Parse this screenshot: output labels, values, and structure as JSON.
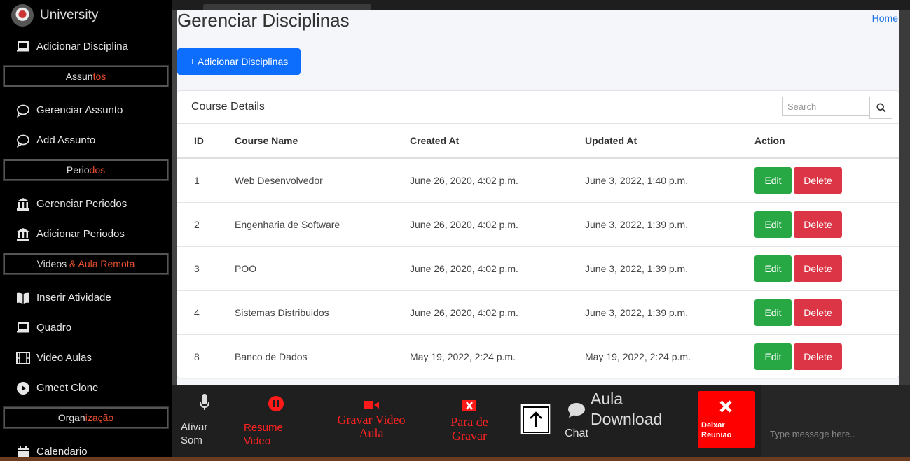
{
  "sidebar": {
    "brand": "University",
    "items_top": [
      {
        "label": "Adicionar Disciplina",
        "icon": "laptop-icon"
      }
    ],
    "sections": [
      {
        "plain": "Assun",
        "accent": "tos",
        "items": [
          {
            "label": "Gerenciar Assunto",
            "icon": "chat-icon"
          },
          {
            "label": "Add Assunto",
            "icon": "chat-icon"
          }
        ]
      },
      {
        "plain": "Perio",
        "accent": "dos",
        "items": [
          {
            "label": "Gerenciar Periodos",
            "icon": "bank-icon"
          },
          {
            "label": "Adicionar Periodos",
            "icon": "bank-icon"
          }
        ]
      },
      {
        "plain": "Videos ",
        "accent": "& Aula Remota",
        "items": [
          {
            "label": "Inserir Atividade",
            "icon": "book-icon"
          },
          {
            "label": "Quadro",
            "icon": "laptop-icon"
          },
          {
            "label": "Video Aulas",
            "icon": "film-icon"
          },
          {
            "label": "Gmeet Clone",
            "icon": "play-icon"
          }
        ]
      },
      {
        "plain": "Organ",
        "accent": "ização",
        "items": [
          {
            "label": "Calendario",
            "icon": "calendar-icon"
          }
        ]
      }
    ]
  },
  "main": {
    "title": "Gerenciar Disciplinas",
    "home": "Home",
    "add_button": "+ Adicionar Disciplinas",
    "card_title": "Course Details",
    "search_placeholder": "Search",
    "columns": [
      "ID",
      "Course Name",
      "Created At",
      "Updated At",
      "Action"
    ],
    "rows": [
      {
        "id": "1",
        "name": "Web Desenvolvedor",
        "created": "June 26, 2020, 4:02 p.m.",
        "updated": "June 3, 2022, 1:40 p.m."
      },
      {
        "id": "2",
        "name": "Engenharia de Software",
        "created": "June 26, 2020, 4:02 p.m.",
        "updated": "June 3, 2022, 1:39 p.m."
      },
      {
        "id": "3",
        "name": "POO",
        "created": "June 26, 2020, 4:02 p.m.",
        "updated": "June 3, 2022, 1:39 p.m."
      },
      {
        "id": "4",
        "name": "Sistemas Distribuidos",
        "created": "June 26, 2020, 4:02 p.m.",
        "updated": "June 3, 2022, 1:39 p.m."
      },
      {
        "id": "8",
        "name": "Banco de Dados",
        "created": "May 19, 2022, 2:24 p.m.",
        "updated": "May 19, 2022, 2:24 p.m."
      }
    ],
    "edit_label": "Edit",
    "delete_label": "Delete"
  },
  "controls": {
    "mic": "Ativar Som",
    "resume": "Resume Video",
    "record": "Gravar Video Aula",
    "stop": "Para de Gravar",
    "chat": "Chat",
    "download": "Aula Download",
    "leave": "Deixar Reuniao",
    "message_placeholder": "Type message here.."
  },
  "colors": {
    "accent": "#e8502f",
    "primary": "#0d6efd",
    "success": "#28a745",
    "danger": "#dc3545",
    "leave": "#ff0000"
  }
}
